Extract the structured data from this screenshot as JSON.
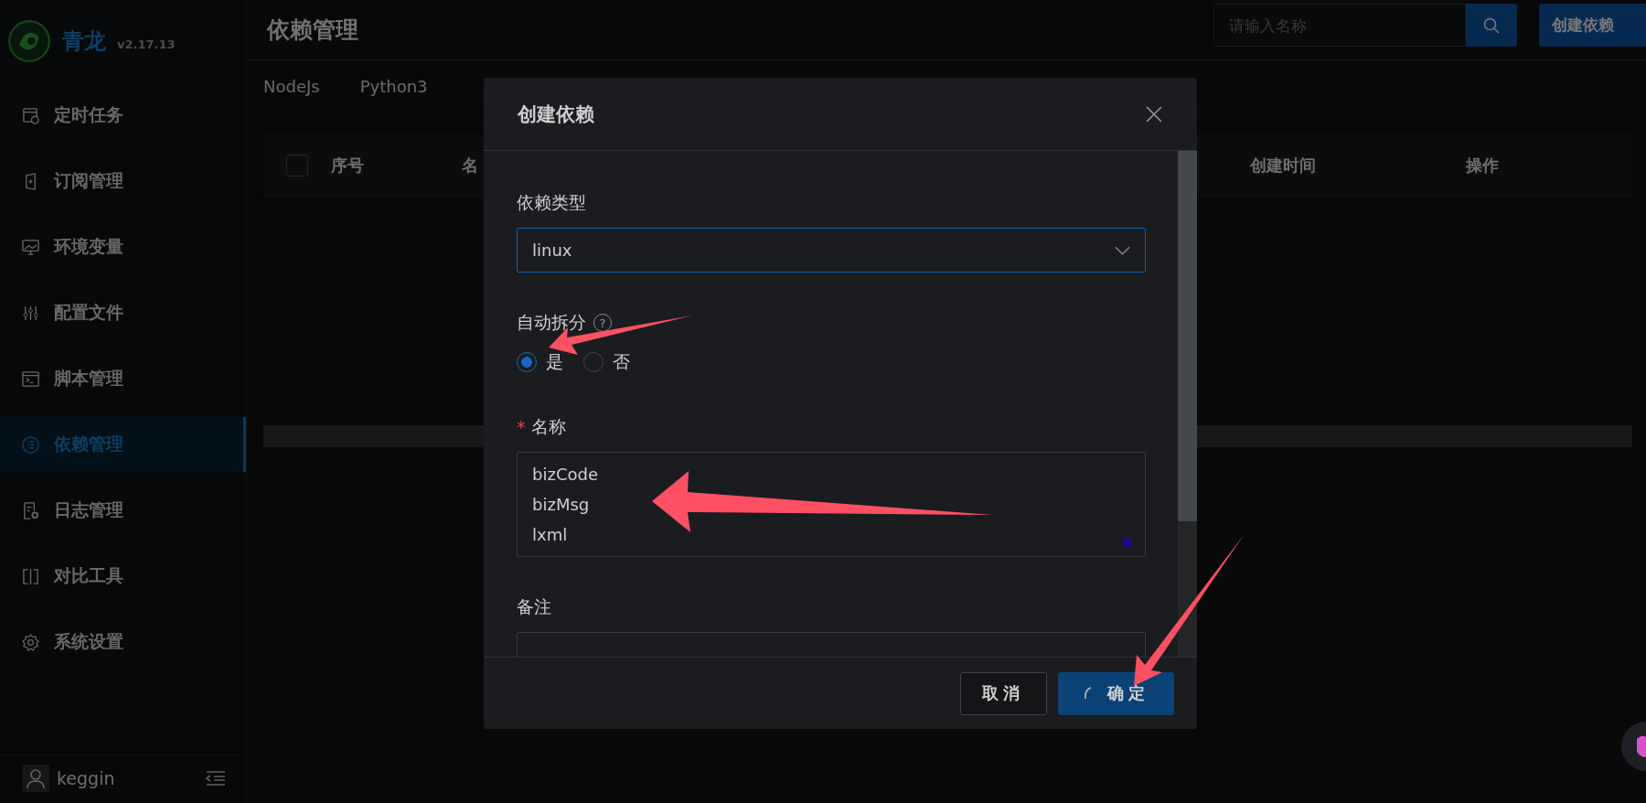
{
  "app": {
    "name": "青龙",
    "version": "v2.17.13"
  },
  "sidebar": {
    "items": [
      {
        "label": "定时任务",
        "selected": false
      },
      {
        "label": "订阅管理",
        "selected": false
      },
      {
        "label": "环境变量",
        "selected": false
      },
      {
        "label": "配置文件",
        "selected": false
      },
      {
        "label": "脚本管理",
        "selected": false
      },
      {
        "label": "依赖管理",
        "selected": true
      },
      {
        "label": "日志管理",
        "selected": false
      },
      {
        "label": "对比工具",
        "selected": false
      },
      {
        "label": "系统设置",
        "selected": false
      }
    ],
    "user": "keggin"
  },
  "header": {
    "title": "依赖管理",
    "search": {
      "placeholder": "请输入名称"
    },
    "create_button": "创建依赖"
  },
  "tabs": [
    {
      "label": "NodeJs"
    },
    {
      "label": "Python3"
    }
  ],
  "table": {
    "select_all_checked": false,
    "columns": [
      "序号",
      "名",
      "创建时间",
      "操作"
    ]
  },
  "modal": {
    "title": "创建依赖",
    "fields": [
      {
        "kind": "select",
        "label": "依赖类型",
        "value": "linux"
      },
      {
        "kind": "radio",
        "label": "自动拆分",
        "hint": "?",
        "options": [
          {
            "label": "是",
            "selected": true
          },
          {
            "label": "否",
            "selected": false
          }
        ]
      },
      {
        "kind": "textarea",
        "label": "名称",
        "required_mark": "*",
        "value": "bizCode\nbizMsg\nlxml"
      },
      {
        "kind": "textarea",
        "label": "备注"
      }
    ],
    "buttons": [
      {
        "label": "取消",
        "kind": "default",
        "loading": false
      },
      {
        "label": "确定",
        "kind": "primary",
        "loading": true
      }
    ]
  }
}
